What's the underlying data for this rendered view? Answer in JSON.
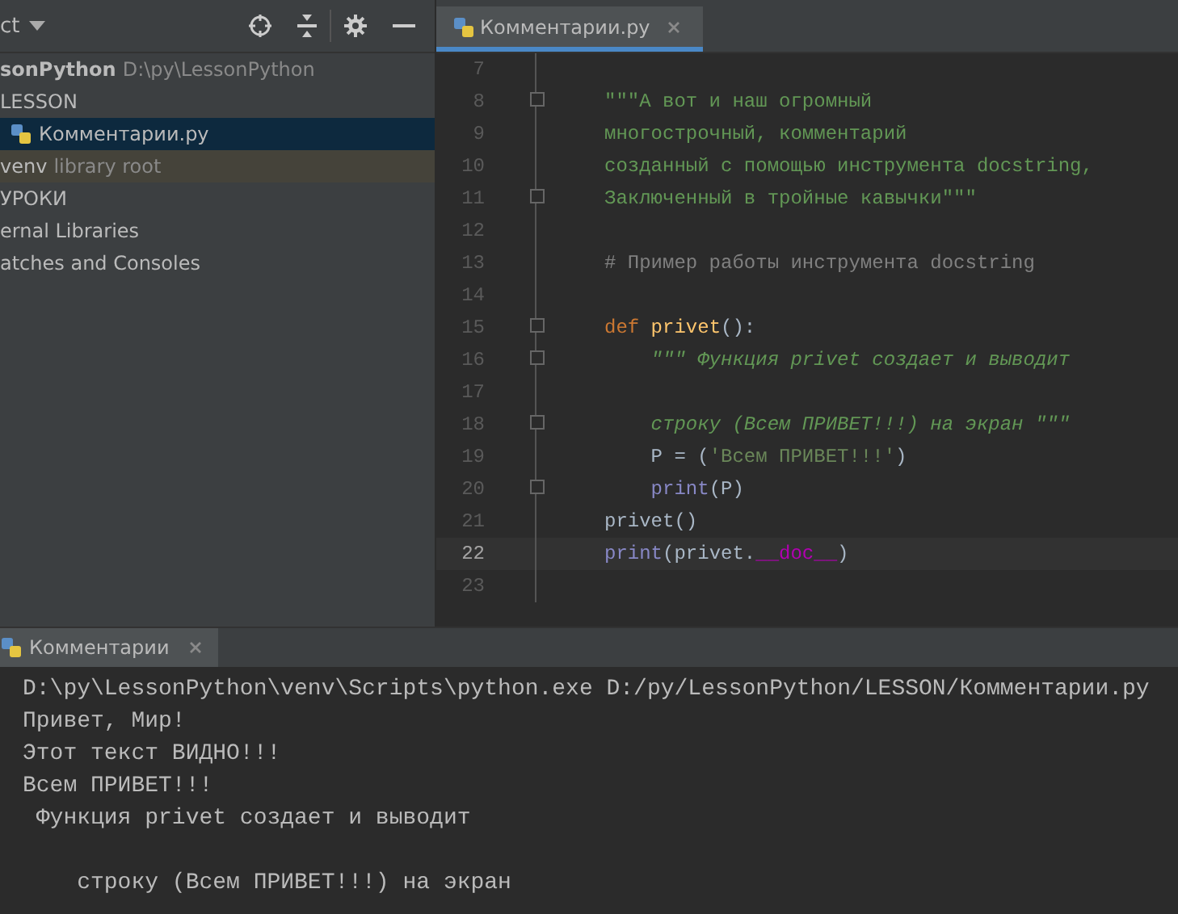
{
  "project_panel": {
    "title": "ct",
    "items": [
      {
        "kind": "project",
        "name": "sonPython",
        "detail": "D:\\py\\LessonPython",
        "selected": false
      },
      {
        "kind": "folder",
        "name": "LESSON",
        "selected": false
      },
      {
        "kind": "file",
        "name": "Комментарии.py",
        "selected": true
      },
      {
        "kind": "library",
        "name": "venv",
        "detail": "library root",
        "selected": false
      },
      {
        "kind": "folder",
        "name": "УРОКИ",
        "selected": false
      },
      {
        "kind": "plain",
        "name": "ernal Libraries",
        "selected": false
      },
      {
        "kind": "plain",
        "name": "atches and Consoles",
        "selected": false
      }
    ]
  },
  "editor": {
    "tabs": [
      {
        "label": "Комментарии.py",
        "selected": true
      }
    ],
    "lines": [
      {
        "number": "7",
        "fold": false,
        "current": false
      },
      {
        "number": "8",
        "fold": true,
        "current": false,
        "segments": [
          {
            "kind": "docstring",
            "text": "\"\"\"А вот и наш огромный"
          }
        ]
      },
      {
        "number": "9",
        "fold": false,
        "current": false,
        "segments": [
          {
            "kind": "docstring",
            "text": "многострочный, комментарий"
          }
        ]
      },
      {
        "number": "10",
        "fold": false,
        "current": false,
        "segments": [
          {
            "kind": "docstring",
            "text": "созданный с помощью инструмента docstring,"
          }
        ]
      },
      {
        "number": "11",
        "fold": true,
        "current": false,
        "segments": [
          {
            "kind": "docstring",
            "text": "Заключенный в тройные кавычки\"\"\""
          }
        ]
      },
      {
        "number": "12",
        "fold": false,
        "current": false
      },
      {
        "number": "13",
        "fold": false,
        "current": false,
        "segments": [
          {
            "kind": "comment",
            "text": "# Пример работы инструмента docstring"
          }
        ]
      },
      {
        "number": "14",
        "fold": false,
        "current": false
      },
      {
        "number": "15",
        "fold": true,
        "current": false,
        "segments": [
          {
            "kind": "keyword",
            "text": "def"
          },
          {
            "kind": "function",
            "text": " privet"
          },
          {
            "kind": "plain",
            "text": "():"
          }
        ]
      },
      {
        "number": "16",
        "fold": true,
        "current": false,
        "segments": [
          {
            "kind": "docitalic",
            "text": "    \"\"\" Функция privet создает и выводит"
          }
        ]
      },
      {
        "number": "17",
        "fold": false,
        "current": false
      },
      {
        "number": "18",
        "fold": true,
        "current": false,
        "segments": [
          {
            "kind": "docitalic",
            "text": "    строку (Всем ПРИВЕТ!!!) на экран \"\"\""
          }
        ]
      },
      {
        "number": "19",
        "fold": false,
        "current": false,
        "segments": [
          {
            "kind": "plain",
            "text": "    P = ("
          },
          {
            "kind": "string",
            "text": "'Всем ПРИВЕТ!!!'"
          },
          {
            "kind": "plain",
            "text": ")"
          }
        ]
      },
      {
        "number": "20",
        "fold": true,
        "current": false,
        "segments": [
          {
            "kind": "builtin",
            "text": "    print"
          },
          {
            "kind": "plain",
            "text": "(P)"
          }
        ]
      },
      {
        "number": "21",
        "fold": false,
        "current": false,
        "segments": [
          {
            "kind": "plain",
            "text": "privet()"
          }
        ]
      },
      {
        "number": "22",
        "fold": false,
        "current": true,
        "segments": [
          {
            "kind": "builtin",
            "text": "print"
          },
          {
            "kind": "plain",
            "text": "(privet."
          },
          {
            "kind": "magic",
            "text": "__doc__"
          },
          {
            "kind": "plain",
            "text": ")"
          }
        ]
      },
      {
        "number": "23",
        "fold": false,
        "current": false
      }
    ]
  },
  "run_panel": {
    "tab": {
      "label": "Комментарии",
      "selected": true
    },
    "output": [
      {
        "kind": "line",
        "text": "D:\\py\\LessonPython\\venv\\Scripts\\python.exe D:/py/LessonPython/LESSON/Комментарии.py"
      },
      {
        "kind": "line",
        "text": "Привет, Мир!"
      },
      {
        "kind": "line",
        "text": "Этот текст ВИДНО!!!"
      },
      {
        "kind": "line",
        "text": "Всем ПРИВЕТ!!!"
      },
      {
        "kind": "line",
        "text": " Функция privet создает и выводит"
      },
      {
        "kind": "after_blank",
        "text": "    строку (Всем ПРИВЕТ!!!) на экран"
      }
    ]
  }
}
